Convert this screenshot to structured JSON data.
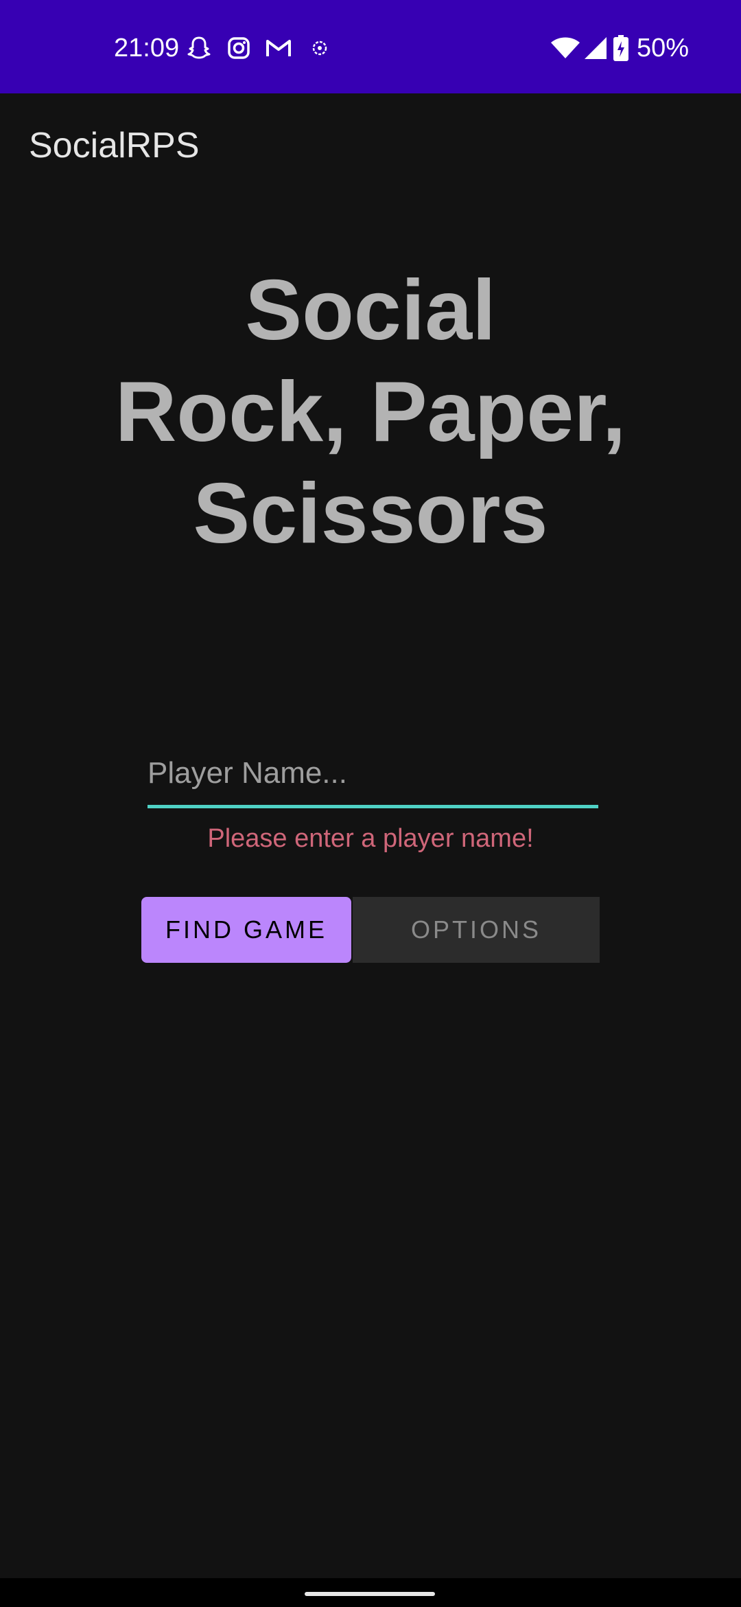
{
  "status_bar": {
    "time": "21:09",
    "notification_icons": [
      "snapchat-icon",
      "instagram-icon",
      "gmail-icon",
      "pokeball-icon"
    ],
    "system_icons": [
      "wifi-icon",
      "cellular-signal-icon",
      "battery-charging-icon"
    ],
    "battery_percent": "50%",
    "background_color": "#3700B3"
  },
  "app_bar": {
    "title": "SocialRPS"
  },
  "hero": {
    "line1": "Social",
    "line2": "Rock, Paper,",
    "line3": "Scissors"
  },
  "player_name": {
    "placeholder": "Player Name...",
    "value": "",
    "error": "Please enter a player name!",
    "underline_color": "#4fd1c5",
    "error_color": "#cf6679"
  },
  "buttons": {
    "find_game_label": "FIND GAME",
    "options_label": "OPTIONS",
    "accent_color": "#BB86FC"
  },
  "nav_bar": {
    "type": "gesture-handle"
  }
}
